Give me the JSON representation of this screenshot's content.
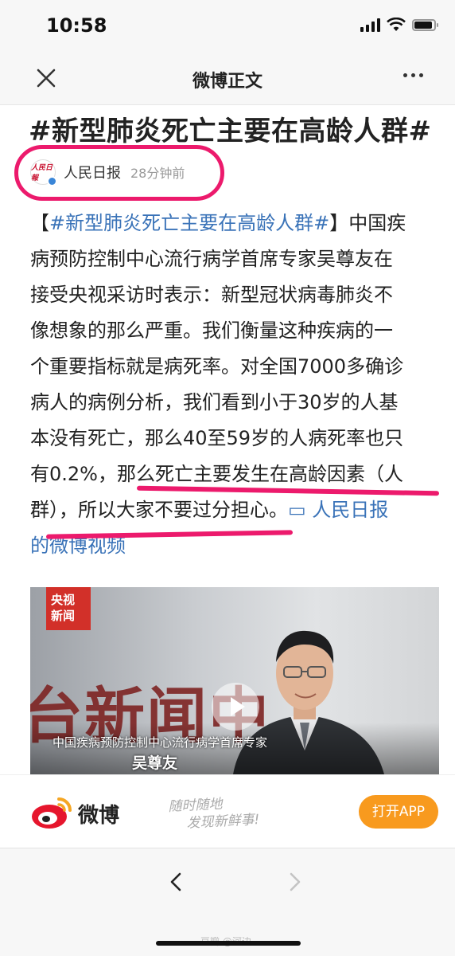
{
  "status_bar": {
    "time": "10:58",
    "battery_level": 0.85
  },
  "nav": {
    "title": "微博正文",
    "close_icon": "close-icon",
    "more_icon": "more-dots-icon"
  },
  "article": {
    "headline": "#新型肺炎死亡主要在高龄人群#",
    "author": "人民日报",
    "time": "28分钟前",
    "avatar_logo": "人民日報",
    "body_lines": [
      {
        "pre": "【",
        "link": "#新型肺炎死亡主要在高龄人群#",
        "post": "】中国疾"
      },
      {
        "text": "病预防控制中心流行病学首席专家吴尊友在"
      },
      {
        "text": "接受央视采访时表示：新型冠状病毒肺炎不"
      },
      {
        "text": "像想象的那么严重。我们衡量这种疾病的一"
      },
      {
        "text": "个重要指标就是病死率。对全国7000多确诊"
      },
      {
        "text": "病人的病例分析，我们看到小于30岁的人基"
      },
      {
        "text": "本没有死亡，那么40至59岁的人病死率也只"
      },
      {
        "text": "有0.2%，那么死亡主要发生在高龄因素（人"
      },
      {
        "pre": "群），所以大家不要过分担心。",
        "link": "▭ 人民日报"
      },
      {
        "link": "的微博视频"
      }
    ]
  },
  "video": {
    "channel_logo_line1": "央视",
    "channel_logo_line2": "新闻",
    "wall_text": "台新闻中",
    "caption": "中国疾病预防控制中心流行病学首席专家",
    "name": "吴尊友",
    "play_icon": "play-icon"
  },
  "banner": {
    "brand": "微博",
    "slogan_line1": "随时随地",
    "slogan_line2": "发现新鲜事!",
    "open_app": "打开APP"
  },
  "bottom": {
    "back_icon": "chevron-left-icon",
    "forward_icon": "chevron-right-icon",
    "watermark": "豆瓣 @河边"
  },
  "colors": {
    "link": "#3a73b8",
    "highlight": "#ec1a6c",
    "open_app_bg": "#f89a1e",
    "weibo_red": "#e6162d"
  }
}
